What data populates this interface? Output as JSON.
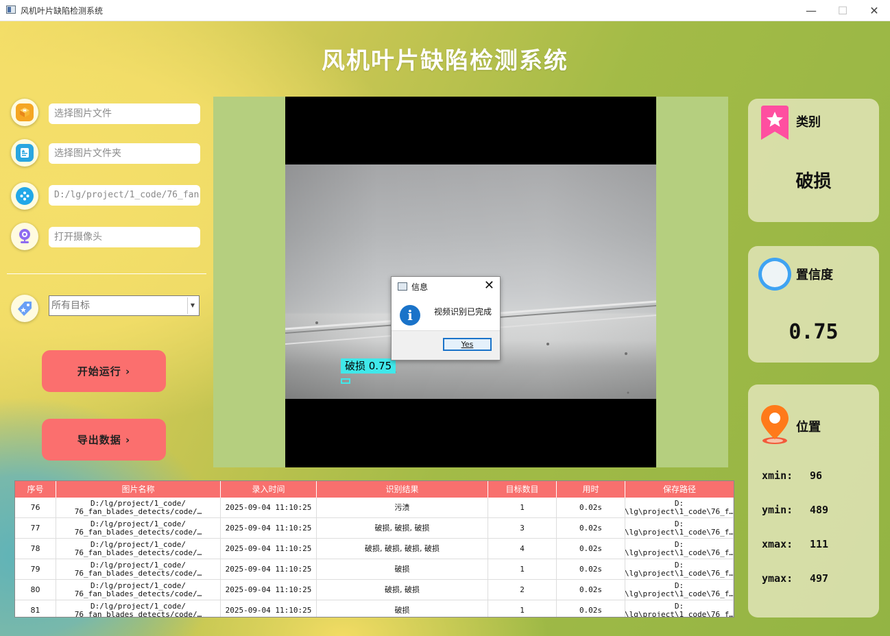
{
  "window": {
    "title": "风机叶片缺陷检测系统",
    "minimize": "—",
    "maximize": "☐",
    "close": "✕"
  },
  "app_title": "风机叶片缺陷检测系统",
  "inputs": {
    "image_file": "选择图片文件",
    "image_folder": "选择图片文件夹",
    "video_path": "D:/lg/project/1_code/76_fan",
    "camera": "打开摄像头"
  },
  "target_select": {
    "value": "所有目标"
  },
  "buttons": {
    "run": "开始运行 ›",
    "export": "导出数据 ›"
  },
  "detection": {
    "label": "破损 0.75"
  },
  "panels": {
    "category": {
      "title": "类别",
      "value": "破损"
    },
    "confidence": {
      "title": "置信度",
      "value": "0.75"
    },
    "position": {
      "title": "位置",
      "xmin_label": "xmin:",
      "xmin": "96",
      "ymin_label": "ymin:",
      "ymin": "489",
      "xmax_label": "xmax:",
      "xmax": "111",
      "ymax_label": "ymax:",
      "ymax": "497"
    }
  },
  "dialog": {
    "title": "信息",
    "message": "视频识别已完成",
    "yes": "Yes",
    "close": "✕"
  },
  "table": {
    "headers": [
      "序号",
      "图片名称",
      "录入时间",
      "识别结果",
      "目标数目",
      "用时",
      "保存路径"
    ],
    "rows": [
      {
        "id": "76",
        "name": "D:/lg/project/1_code/\n76_fan_blades_detects/code/…",
        "time": "2025-09-04 11:10:25",
        "result": "污渍",
        "count": "1",
        "elapsed": "0.02s",
        "path": "D:\n\\lg\\project\\1_code\\76_f…"
      },
      {
        "id": "77",
        "name": "D:/lg/project/1_code/\n76_fan_blades_detects/code/…",
        "time": "2025-09-04 11:10:25",
        "result": "破损, 破损, 破损",
        "count": "3",
        "elapsed": "0.02s",
        "path": "D:\n\\lg\\project\\1_code\\76_f…"
      },
      {
        "id": "78",
        "name": "D:/lg/project/1_code/\n76_fan_blades_detects/code/…",
        "time": "2025-09-04 11:10:25",
        "result": "破损, 破损, 破损, 破损",
        "count": "4",
        "elapsed": "0.02s",
        "path": "D:\n\\lg\\project\\1_code\\76_f…"
      },
      {
        "id": "79",
        "name": "D:/lg/project/1_code/\n76_fan_blades_detects/code/…",
        "time": "2025-09-04 11:10:25",
        "result": "破损",
        "count": "1",
        "elapsed": "0.02s",
        "path": "D:\n\\lg\\project\\1_code\\76_f…"
      },
      {
        "id": "80",
        "name": "D:/lg/project/1_code/\n76_fan_blades_detects/code/…",
        "time": "2025-09-04 11:10:25",
        "result": "破损, 破损",
        "count": "2",
        "elapsed": "0.02s",
        "path": "D:\n\\lg\\project\\1_code\\76_f…"
      },
      {
        "id": "81",
        "name": "D:/lg/project/1_code/\n76_fan_blades_detects/code/…",
        "time": "2025-09-04 11:10:25",
        "result": "破损",
        "count": "1",
        "elapsed": "0.02s",
        "path": "D:\n\\lg\\project\\1_code\\76_f…"
      }
    ]
  },
  "colors": {
    "accent_button": "#fb6f6e",
    "table_header": "#f8706e",
    "detection_box": "#40e8ea",
    "display_bg": "#b5cf7f"
  },
  "icons": {
    "file": "image-file-icon",
    "folder": "image-folder-icon",
    "video": "video-icon",
    "camera": "camera-icon",
    "target": "target-tag-icon",
    "category": "bookmark-star-icon",
    "confidence": "ring-icon",
    "position": "location-pin-icon"
  }
}
